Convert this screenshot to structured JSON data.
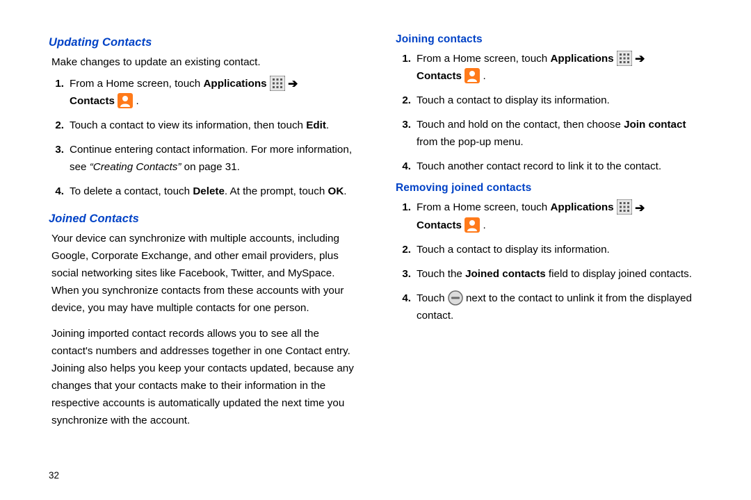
{
  "page_number": "32",
  "left": {
    "section1": {
      "title": "Updating Contacts",
      "intro": "Make changes to update an existing contact.",
      "steps": {
        "s1_a": "From a Home screen, touch ",
        "s1_apps": "Applications",
        "s1_contacts": "Contacts",
        "s1_period": " .",
        "s2_a": "Touch a contact to view its information, then touch ",
        "s2_b": "Edit",
        "s2_c": ".",
        "s3_a": "Continue entering contact information. For more information, see ",
        "s3_xref": "“Creating Contacts”",
        "s3_b": " on page 31.",
        "s4_a": "To delete a contact, touch ",
        "s4_b": "Delete",
        "s4_c": ". At the prompt, touch ",
        "s4_d": "OK",
        "s4_e": "."
      }
    },
    "section2": {
      "title": "Joined Contacts",
      "p1": "Your device can synchronize with multiple accounts, including Google, Corporate Exchange, and other email providers, plus social networking sites like Facebook, Twitter, and MySpace. When you synchronize contacts from these accounts with your device, you may have multiple contacts for one person.",
      "p2": "Joining imported contact records allows you to see all the contact's numbers and addresses together in one Contact entry. Joining also helps you keep your contacts updated, because any changes that your contacts make to their information in the respective accounts is automatically updated the next time you synchronize with the account."
    }
  },
  "right": {
    "sub1": {
      "title": "Joining contacts",
      "steps": {
        "s1_a": "From a Home screen, touch ",
        "s1_apps": "Applications",
        "s1_contacts": "Contacts",
        "s1_period": " .",
        "s2": "Touch a contact to display its information.",
        "s3_a": "Touch and hold on the contact, then choose ",
        "s3_b": "Join contact",
        "s3_c": " from the pop-up menu.",
        "s4": "Touch another contact record to link it to the contact."
      }
    },
    "sub2": {
      "title": "Removing joined contacts",
      "steps": {
        "s1_a": "From a Home screen, touch ",
        "s1_apps": "Applications",
        "s1_contacts": "Contacts",
        "s1_period": " .",
        "s2": "Touch a contact to display its information.",
        "s3_a": "Touch the ",
        "s3_b": "Joined contacts",
        "s3_c": " field to display joined contacts.",
        "s4_a": "Touch ",
        "s4_b": " next to the contact to unlink it from the displayed contact."
      }
    }
  }
}
